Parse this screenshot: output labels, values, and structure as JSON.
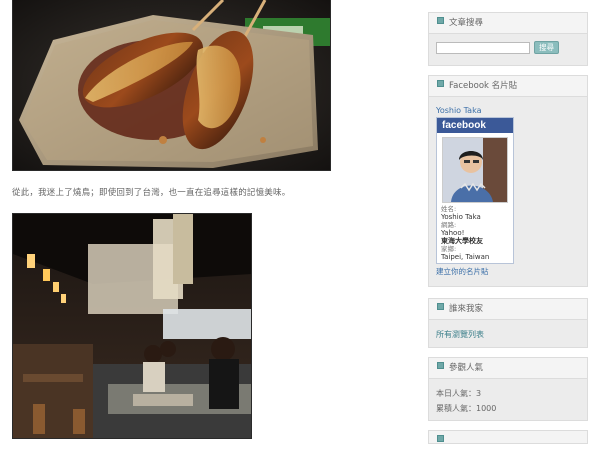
{
  "article": {
    "caption": "從此，我迷上了燒鳥；即使回到了台灣，也一直在追尋這樣的記憶美味。"
  },
  "sidebar": {
    "search": {
      "title": "文章搜尋",
      "input_value": "",
      "button_label": "搜尋"
    },
    "facebook": {
      "title": "Facebook 名片貼",
      "name_link": "Yoshio Taka",
      "logo_text": "facebook",
      "name_label": "姓名:",
      "name_value": "Yoshio Taka",
      "network_label": "網路:",
      "network_values": [
        "Yahoo!",
        "東海大學校友"
      ],
      "home_label": "家鄉:",
      "home_value": "Taipei, Taiwan",
      "create_link": "建立你的名片貼"
    },
    "friends": {
      "title": "誰來我家",
      "link": "所有瀏覽列表"
    },
    "visitors": {
      "title": "參觀人氣",
      "today": "本日人氣：3",
      "total": "累積人氣：1000"
    }
  },
  "colors": {
    "accent": "#6fa8a8",
    "facebook": "#3b5998",
    "link": "#3b6fa8"
  }
}
